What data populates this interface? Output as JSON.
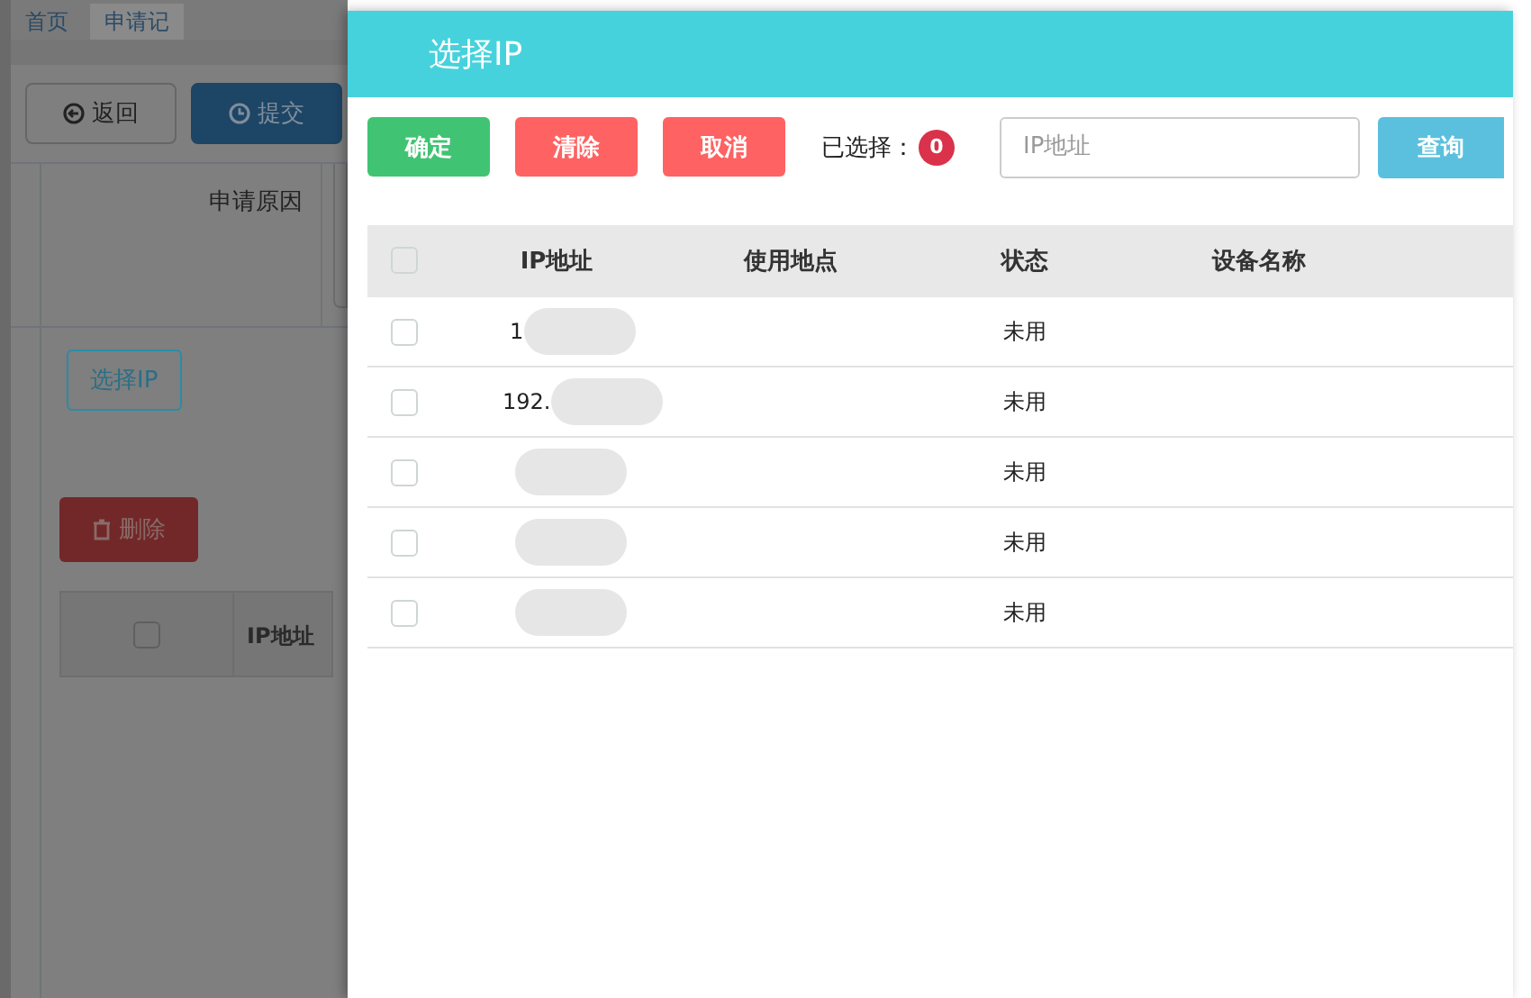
{
  "background_page": {
    "tabs": [
      {
        "label": "首页",
        "selected": false
      },
      {
        "label": "申请记",
        "selected": true
      }
    ],
    "buttons": [
      {
        "label": "返回",
        "kind": "outline"
      },
      {
        "label": "提交",
        "kind": "primary"
      }
    ],
    "form": {
      "label": "申请原因"
    },
    "select_button": "选择IP",
    "delete_button": "删除",
    "table": {
      "columns": [
        "IP地址"
      ],
      "select_all_checked": false
    }
  },
  "dialog": {
    "title": "选择IP",
    "toolbar": {
      "buttons": [
        {
          "label": "确定",
          "kind": "success"
        },
        {
          "label": "清除",
          "kind": "danger"
        },
        {
          "label": "取消",
          "kind": "danger"
        }
      ],
      "selected_label": "已选择：",
      "selected_count": "0",
      "search": {
        "placeholder": "IP地址"
      },
      "query_button": "查询"
    },
    "table": {
      "columns": [
        "IP地址",
        "使用地点",
        "状态",
        "设备名称"
      ],
      "select_all_checked": false,
      "rows": [
        {
          "ip": "1",
          "checked": false,
          "status": "未用"
        },
        {
          "ip": "192.",
          "checked": false,
          "status": "未用"
        },
        {
          "checked": false,
          "status": "未用"
        },
        {
          "checked": false,
          "status": "未用"
        },
        {
          "checked": false,
          "status": "未用"
        }
      ]
    }
  }
}
